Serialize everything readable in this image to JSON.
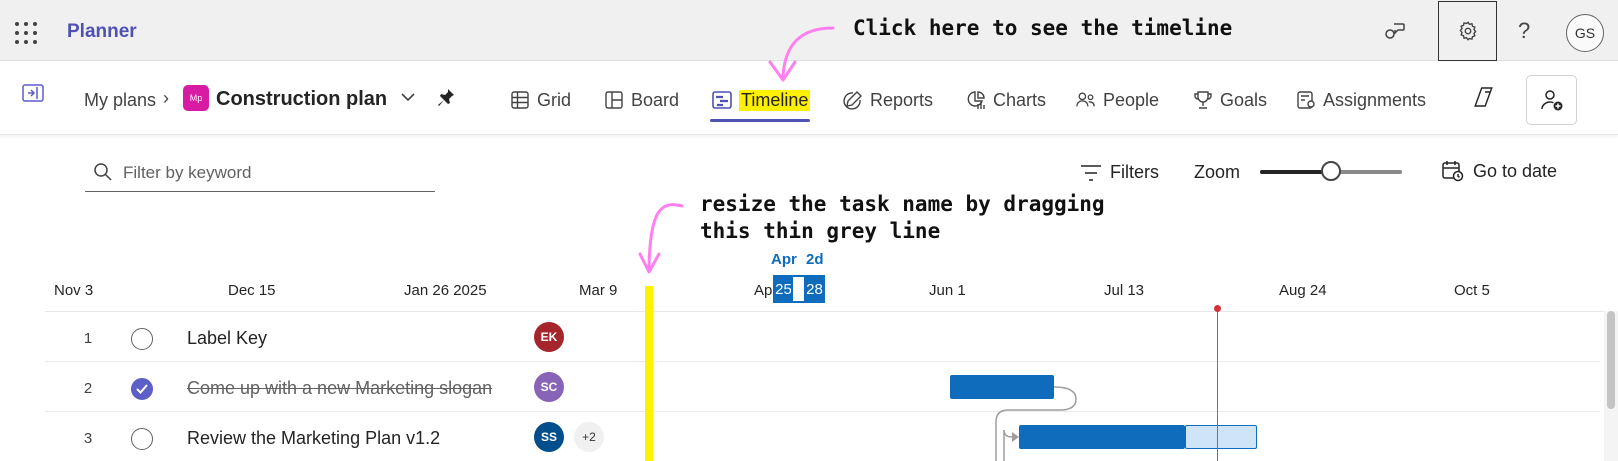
{
  "app": {
    "name": "Planner"
  },
  "header": {
    "avatar_initials": "GS",
    "help_glyph": "?"
  },
  "plan": {
    "breadcrumb": "My plans",
    "badge": "Mp",
    "title": "Construction plan"
  },
  "views": [
    {
      "label": "Grid",
      "icon": "grid-icon"
    },
    {
      "label": "Board",
      "icon": "board-icon"
    },
    {
      "label": "Timeline",
      "icon": "timeline-icon",
      "active": true
    },
    {
      "label": "Reports",
      "icon": "reports-icon"
    },
    {
      "label": "Charts",
      "icon": "charts-icon"
    },
    {
      "label": "People",
      "icon": "people-icon"
    },
    {
      "label": "Goals",
      "icon": "trophy-icon"
    },
    {
      "label": "Assignments",
      "icon": "assignments-icon"
    }
  ],
  "filter": {
    "placeholder": "Filter by keyword",
    "filters_label": "Filters",
    "zoom_label": "Zoom",
    "zoom_level": 0.5,
    "goto_label": "Go to date"
  },
  "timeline": {
    "dates": [
      "Nov 3",
      "Dec 15",
      "Jan 26 2025",
      "Mar 9",
      "Ap",
      "Jun 1",
      "Jul 13",
      "Aug 24",
      "Oct 5"
    ],
    "selection": {
      "month": "Apr",
      "duration": "2d",
      "start_day": "25",
      "end_day": "28"
    }
  },
  "tasks": [
    {
      "num": "1",
      "name": "Label Key",
      "done": false,
      "assignees": [
        {
          "initials": "EK",
          "color": "#a4262c"
        }
      ],
      "extra": ""
    },
    {
      "num": "2",
      "name": "Come up with a new Marketing slogan",
      "done": true,
      "assignees": [
        {
          "initials": "SC",
          "color": "#8764b8"
        }
      ],
      "extra": ""
    },
    {
      "num": "3",
      "name": "Review the Marketing Plan v1.2",
      "done": false,
      "assignees": [
        {
          "initials": "SS",
          "color": "#004e8c"
        }
      ],
      "extra": "+2"
    }
  ],
  "annotations": {
    "top": "Click here to see the timeline",
    "middle_line1": "resize the task name by dragging",
    "middle_line2": "this thin grey line"
  },
  "colors": {
    "brand": "#4f52b2",
    "bar": "#0f6cbd",
    "today": "#d13438",
    "highlight": "#ffef00",
    "arrow": "#ff7ff0"
  }
}
